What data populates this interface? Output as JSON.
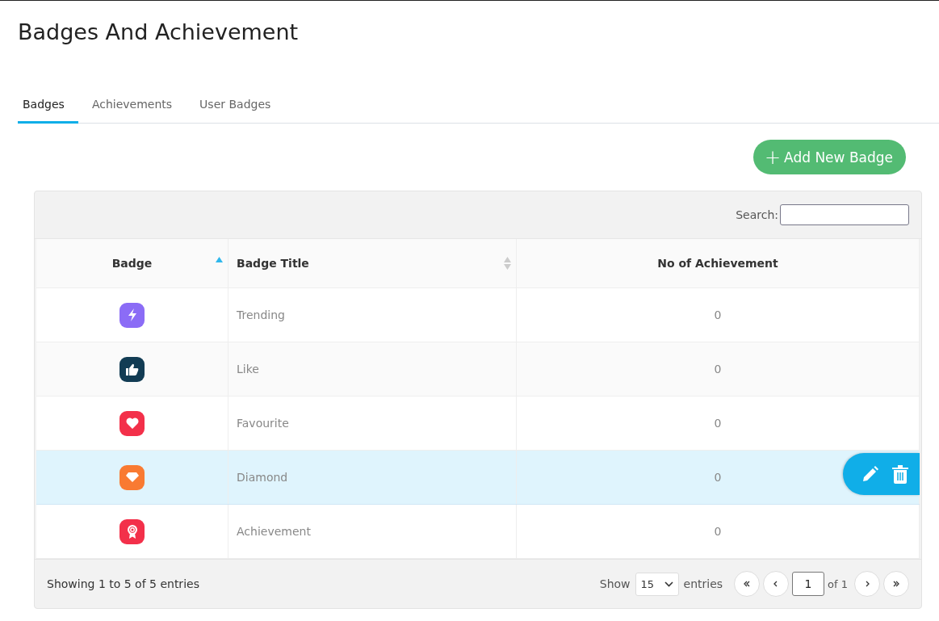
{
  "page_title": "Badges And Achievement",
  "tabs": [
    {
      "label": "Badges",
      "selected": true
    },
    {
      "label": "Achievements",
      "selected": false
    },
    {
      "label": "User Badges",
      "selected": false
    }
  ],
  "add_button": {
    "label": "Add New Badge",
    "icon": "+"
  },
  "search": {
    "label": "Search:"
  },
  "table": {
    "columns": [
      {
        "label": "Badge",
        "kind": "sorted"
      },
      {
        "label": "Badge Title",
        "kind": "sortable"
      },
      {
        "label": "No of Achievement",
        "kind": "plain"
      }
    ],
    "rows": [
      {
        "kind": "bolt",
        "color": "#8b6cf6",
        "title": "Trending",
        "count": "0",
        "selected": false
      },
      {
        "kind": "thumb",
        "color": "#123c54",
        "title": "Like",
        "count": "0",
        "selected": false
      },
      {
        "kind": "heart",
        "color": "#f3304a",
        "title": "Favourite",
        "count": "0",
        "selected": false
      },
      {
        "kind": "diamond",
        "color": "#f97a32",
        "title": "Diamond",
        "count": "0",
        "selected": true
      },
      {
        "kind": "award",
        "color": "#f3304a",
        "title": "Achievement",
        "count": "0",
        "selected": false
      }
    ]
  },
  "footer": {
    "info": "Showing 1 to 5 of 5 entries",
    "show_label": "Show",
    "page_size": "15",
    "entries_label": "entries",
    "page": "1",
    "page_of": "of 1"
  }
}
